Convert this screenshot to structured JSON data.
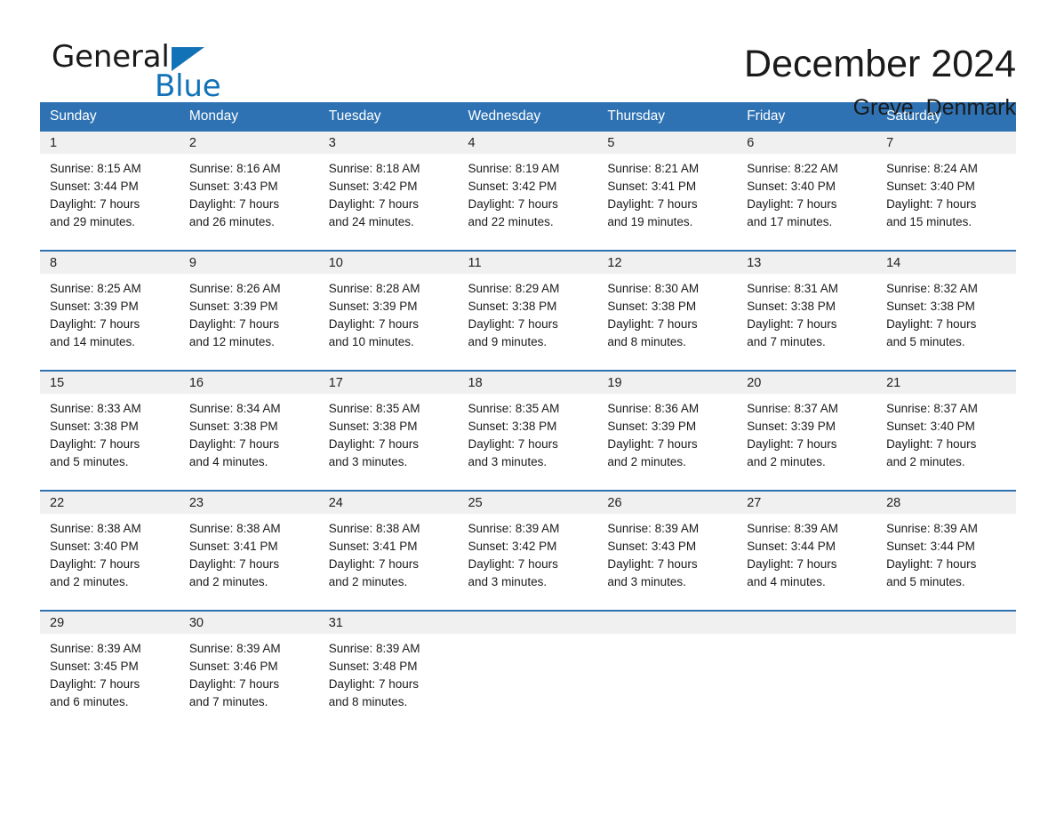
{
  "brand": {
    "name_part1": "General",
    "name_part2": "Blue",
    "triangle_icon": "triangle-icon",
    "colors": {
      "blue": "#1272B8",
      "black": "#1a1a1a"
    }
  },
  "header": {
    "month_title": "December 2024",
    "location": "Greve, Denmark"
  },
  "theme": {
    "header_blue": "#2E72B3",
    "date_strip_gray": "#F0F0F0",
    "row_separator": "#2E72B3"
  },
  "calendar": {
    "weekday_headers": [
      "Sunday",
      "Monday",
      "Tuesday",
      "Wednesday",
      "Thursday",
      "Friday",
      "Saturday"
    ],
    "weeks": [
      [
        {
          "day": "1",
          "text": "Sunrise: 8:15 AM\nSunset: 3:44 PM\nDaylight: 7 hours\nand 29 minutes."
        },
        {
          "day": "2",
          "text": "Sunrise: 8:16 AM\nSunset: 3:43 PM\nDaylight: 7 hours\nand 26 minutes."
        },
        {
          "day": "3",
          "text": "Sunrise: 8:18 AM\nSunset: 3:42 PM\nDaylight: 7 hours\nand 24 minutes."
        },
        {
          "day": "4",
          "text": "Sunrise: 8:19 AM\nSunset: 3:42 PM\nDaylight: 7 hours\nand 22 minutes."
        },
        {
          "day": "5",
          "text": "Sunrise: 8:21 AM\nSunset: 3:41 PM\nDaylight: 7 hours\nand 19 minutes."
        },
        {
          "day": "6",
          "text": "Sunrise: 8:22 AM\nSunset: 3:40 PM\nDaylight: 7 hours\nand 17 minutes."
        },
        {
          "day": "7",
          "text": "Sunrise: 8:24 AM\nSunset: 3:40 PM\nDaylight: 7 hours\nand 15 minutes."
        }
      ],
      [
        {
          "day": "8",
          "text": "Sunrise: 8:25 AM\nSunset: 3:39 PM\nDaylight: 7 hours\nand 14 minutes."
        },
        {
          "day": "9",
          "text": "Sunrise: 8:26 AM\nSunset: 3:39 PM\nDaylight: 7 hours\nand 12 minutes."
        },
        {
          "day": "10",
          "text": "Sunrise: 8:28 AM\nSunset: 3:39 PM\nDaylight: 7 hours\nand 10 minutes."
        },
        {
          "day": "11",
          "text": "Sunrise: 8:29 AM\nSunset: 3:38 PM\nDaylight: 7 hours\nand 9 minutes."
        },
        {
          "day": "12",
          "text": "Sunrise: 8:30 AM\nSunset: 3:38 PM\nDaylight: 7 hours\nand 8 minutes."
        },
        {
          "day": "13",
          "text": "Sunrise: 8:31 AM\nSunset: 3:38 PM\nDaylight: 7 hours\nand 7 minutes."
        },
        {
          "day": "14",
          "text": "Sunrise: 8:32 AM\nSunset: 3:38 PM\nDaylight: 7 hours\nand 5 minutes."
        }
      ],
      [
        {
          "day": "15",
          "text": "Sunrise: 8:33 AM\nSunset: 3:38 PM\nDaylight: 7 hours\nand 5 minutes."
        },
        {
          "day": "16",
          "text": "Sunrise: 8:34 AM\nSunset: 3:38 PM\nDaylight: 7 hours\nand 4 minutes."
        },
        {
          "day": "17",
          "text": "Sunrise: 8:35 AM\nSunset: 3:38 PM\nDaylight: 7 hours\nand 3 minutes."
        },
        {
          "day": "18",
          "text": "Sunrise: 8:35 AM\nSunset: 3:38 PM\nDaylight: 7 hours\nand 3 minutes."
        },
        {
          "day": "19",
          "text": "Sunrise: 8:36 AM\nSunset: 3:39 PM\nDaylight: 7 hours\nand 2 minutes."
        },
        {
          "day": "20",
          "text": "Sunrise: 8:37 AM\nSunset: 3:39 PM\nDaylight: 7 hours\nand 2 minutes."
        },
        {
          "day": "21",
          "text": "Sunrise: 8:37 AM\nSunset: 3:40 PM\nDaylight: 7 hours\nand 2 minutes."
        }
      ],
      [
        {
          "day": "22",
          "text": "Sunrise: 8:38 AM\nSunset: 3:40 PM\nDaylight: 7 hours\nand 2 minutes."
        },
        {
          "day": "23",
          "text": "Sunrise: 8:38 AM\nSunset: 3:41 PM\nDaylight: 7 hours\nand 2 minutes."
        },
        {
          "day": "24",
          "text": "Sunrise: 8:38 AM\nSunset: 3:41 PM\nDaylight: 7 hours\nand 2 minutes."
        },
        {
          "day": "25",
          "text": "Sunrise: 8:39 AM\nSunset: 3:42 PM\nDaylight: 7 hours\nand 3 minutes."
        },
        {
          "day": "26",
          "text": "Sunrise: 8:39 AM\nSunset: 3:43 PM\nDaylight: 7 hours\nand 3 minutes."
        },
        {
          "day": "27",
          "text": "Sunrise: 8:39 AM\nSunset: 3:44 PM\nDaylight: 7 hours\nand 4 minutes."
        },
        {
          "day": "28",
          "text": "Sunrise: 8:39 AM\nSunset: 3:44 PM\nDaylight: 7 hours\nand 5 minutes."
        }
      ],
      [
        {
          "day": "29",
          "text": "Sunrise: 8:39 AM\nSunset: 3:45 PM\nDaylight: 7 hours\nand 6 minutes."
        },
        {
          "day": "30",
          "text": "Sunrise: 8:39 AM\nSunset: 3:46 PM\nDaylight: 7 hours\nand 7 minutes."
        },
        {
          "day": "31",
          "text": "Sunrise: 8:39 AM\nSunset: 3:48 PM\nDaylight: 7 hours\nand 8 minutes."
        },
        {
          "day": "",
          "text": ""
        },
        {
          "day": "",
          "text": ""
        },
        {
          "day": "",
          "text": ""
        },
        {
          "day": "",
          "text": ""
        }
      ]
    ]
  }
}
